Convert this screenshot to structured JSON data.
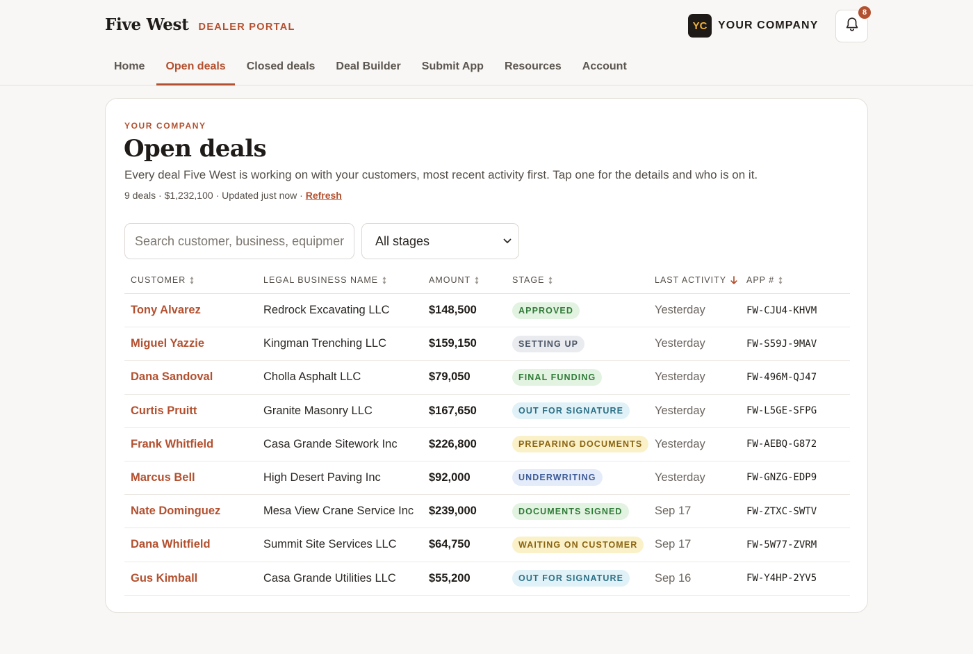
{
  "brand": {
    "name": "Five West",
    "portal": "DEALER PORTAL"
  },
  "company": {
    "initials": "YC",
    "name": "YOUR COMPANY"
  },
  "notifications": {
    "count": "8"
  },
  "nav": [
    {
      "label": "Home",
      "active": false
    },
    {
      "label": "Open deals",
      "active": true
    },
    {
      "label": "Closed deals",
      "active": false
    },
    {
      "label": "Deal Builder",
      "active": false
    },
    {
      "label": "Submit App",
      "active": false
    },
    {
      "label": "Resources",
      "active": false
    },
    {
      "label": "Account",
      "active": false
    }
  ],
  "main": {
    "eyebrow": "YOUR COMPANY",
    "title": "Open deals",
    "subtitle": "Every deal Five West is working on with your customers, most recent activity first. Tap one for the details and who is on it.",
    "meta": "9 deals · $1,232,100 · Updated just now · ",
    "refresh_label": "Refresh"
  },
  "filters": {
    "search_placeholder": "Search customer, business, equipment",
    "stage_selected": "All stages"
  },
  "colors": {
    "accent": "#b3502f",
    "text": "#1f1b18",
    "background": "#f8f7f5"
  },
  "table": {
    "columns": [
      {
        "label": "CUSTOMER",
        "sort": "none"
      },
      {
        "label": "LEGAL BUSINESS NAME",
        "sort": "none"
      },
      {
        "label": "AMOUNT",
        "sort": "none"
      },
      {
        "label": "STAGE",
        "sort": "none"
      },
      {
        "label": "LAST ACTIVITY",
        "sort": "desc"
      },
      {
        "label": "APP #",
        "sort": "none"
      }
    ],
    "rows": [
      {
        "customer": "Tony Alvarez",
        "legal": "Redrock Excavating LLC",
        "amount": "$148,500",
        "stage": "APPROVED",
        "stage_tone": "green",
        "activity": "Yesterday",
        "app": "FW-CJU4-KHVM"
      },
      {
        "customer": "Miguel Yazzie",
        "legal": "Kingman Trenching LLC",
        "amount": "$159,150",
        "stage": "SETTING UP",
        "stage_tone": "gray",
        "activity": "Yesterday",
        "app": "FW-S59J-9MAV"
      },
      {
        "customer": "Dana Sandoval",
        "legal": "Cholla Asphalt LLC",
        "amount": "$79,050",
        "stage": "FINAL FUNDING",
        "stage_tone": "green",
        "activity": "Yesterday",
        "app": "FW-496M-QJ47"
      },
      {
        "customer": "Curtis Pruitt",
        "legal": "Granite Masonry LLC",
        "amount": "$167,650",
        "stage": "OUT FOR SIGNATURE",
        "stage_tone": "blue",
        "activity": "Yesterday",
        "app": "FW-L5GE-SFPG"
      },
      {
        "customer": "Frank Whitfield",
        "legal": "Casa Grande Sitework Inc",
        "amount": "$226,800",
        "stage": "PREPARING DOCUMENTS",
        "stage_tone": "yellow",
        "activity": "Yesterday",
        "app": "FW-AEBQ-G872"
      },
      {
        "customer": "Marcus Bell",
        "legal": "High Desert Paving Inc",
        "amount": "$92,000",
        "stage": "UNDERWRITING",
        "stage_tone": "indigo",
        "activity": "Yesterday",
        "app": "FW-GNZG-EDP9"
      },
      {
        "customer": "Nate Dominguez",
        "legal": "Mesa View Crane Service Inc",
        "amount": "$239,000",
        "stage": "DOCUMENTS SIGNED",
        "stage_tone": "green",
        "activity": "Sep 17",
        "app": "FW-ZTXC-SWTV"
      },
      {
        "customer": "Dana Whitfield",
        "legal": "Summit Site Services LLC",
        "amount": "$64,750",
        "stage": "WAITING ON CUSTOMER",
        "stage_tone": "yellow",
        "activity": "Sep 17",
        "app": "FW-5W77-ZVRM"
      },
      {
        "customer": "Gus Kimball",
        "legal": "Casa Grande Utilities LLC",
        "amount": "$55,200",
        "stage": "OUT FOR SIGNATURE",
        "stage_tone": "blue",
        "activity": "Sep 16",
        "app": "FW-Y4HP-2YV5"
      }
    ]
  }
}
